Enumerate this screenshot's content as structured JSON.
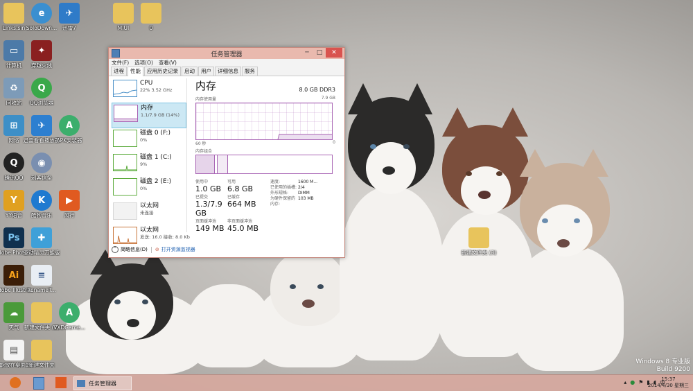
{
  "desktop": {
    "icons": [
      {
        "label": "Links.sin",
        "icon": "folder-icon"
      },
      {
        "label": "SoloDown...",
        "icon": "browser-icon"
      },
      {
        "label": "迅雷7",
        "icon": "thunder-icon"
      },
      {
        "label": "MIUI",
        "icon": "folder-icon"
      },
      {
        "label": "0",
        "icon": "folder-icon"
      },
      {
        "label": "计算机",
        "icon": "computer-icon"
      },
      {
        "label": "穿越火线",
        "icon": "game-icon"
      },
      {
        "label": "回收站",
        "icon": "recycle-bin-icon"
      },
      {
        "label": "QQ浏览器",
        "icon": "qq-browser-icon"
      },
      {
        "label": "网络",
        "icon": "network-icon"
      },
      {
        "label": "迅雷看看播放器",
        "icon": "player-icon"
      },
      {
        "label": "APK安装器",
        "icon": "apk-icon"
      },
      {
        "label": "腾讯QQ",
        "icon": "qq-icon"
      },
      {
        "label": "刺客信条",
        "icon": "disc-icon"
      },
      {
        "label": "YY语音",
        "icon": "yy-icon"
      },
      {
        "label": "酷狗音乐",
        "icon": "kugou-icon"
      },
      {
        "label": "风行",
        "icon": "fengxing-icon"
      },
      {
        "label": "Adobe Photosh...",
        "icon": "photoshop-icon"
      },
      {
        "label": "驱动精灵万能版",
        "icon": "driver-icon"
      },
      {
        "label": "Adobe Illustra...",
        "icon": "illustrator-icon"
      },
      {
        "label": "RenameT...",
        "icon": "document-icon"
      },
      {
        "label": "天气",
        "icon": "weather-icon"
      },
      {
        "label": "新建文件夹 (2)",
        "icon": "folder-icon"
      },
      {
        "label": "VXDGame...",
        "icon": "apk-icon"
      },
      {
        "label": "不能放在桌面的文件",
        "icon": "document-icon"
      },
      {
        "label": "新建文件夹",
        "icon": "folder-icon"
      },
      {
        "label": "新建文件夹 (3)",
        "icon": "folder-icon"
      }
    ]
  },
  "window": {
    "title": "任务管理器",
    "buttons": {
      "minimize": "─",
      "maximize": "□",
      "close": "✕"
    },
    "menu": [
      "文件(F)",
      "选项(O)",
      "查看(V)"
    ],
    "tabs": [
      "进程",
      "性能",
      "应用历史记录",
      "启动",
      "用户",
      "详细信息",
      "服务"
    ],
    "active_tab": "性能"
  },
  "resources": [
    {
      "name": "CPU",
      "sub": "22%  3.52 GHz",
      "color": "#4a90c8"
    },
    {
      "name": "内存",
      "sub": "1.1/7.9 GB (14%)",
      "color": "#a864b4",
      "selected": true
    },
    {
      "name": "磁盘 0 (F:)",
      "sub": "0%",
      "color": "#5aaa3a"
    },
    {
      "name": "磁盘 1 (C:)",
      "sub": "9%",
      "color": "#5aaa3a"
    },
    {
      "name": "磁盘 2 (E:)",
      "sub": "0%",
      "color": "#5aaa3a"
    },
    {
      "name": "以太网",
      "sub": "未连接",
      "color": "#b0b0b0"
    },
    {
      "name": "以太网",
      "sub": "发送: 16.0  接收: 8.0 Kb",
      "color": "#c8743a"
    }
  ],
  "memory": {
    "title": "内存",
    "spec": "8.0 GB DDR3",
    "usage_caption": "内存使用量",
    "usage_max": "7.9 GB",
    "usage_fraction": 0.14,
    "time_left": "60 秒",
    "time_right": "0",
    "composition_caption": "内存组合",
    "stats": [
      {
        "key": "使用中",
        "value": "1.0 GB"
      },
      {
        "key": "可用",
        "value": "6.8 GB"
      },
      {
        "key": "已提交",
        "value": "1.3/7.9 GB"
      },
      {
        "key": "已缓存",
        "value": "664 MB"
      },
      {
        "key": "页面缓冲池",
        "value": "149 MB"
      },
      {
        "key": "非页面缓冲池",
        "value": "45.0 MB"
      }
    ],
    "details": [
      {
        "key": "速度:",
        "value": "1600 M..."
      },
      {
        "key": "已使用的插槽:",
        "value": "2/4"
      },
      {
        "key": "外形规格:",
        "value": "DIMM"
      },
      {
        "key": "为硬件保留的内存:",
        "value": "103 MB"
      }
    ]
  },
  "footer": {
    "less_details": "简略信息(D)",
    "open_monitor": "打开资源监视器"
  },
  "taskbar": {
    "app_label": "任务管理器",
    "tray_lang": "中",
    "time": "15:37",
    "date": "2014/4/30 星期三"
  },
  "watermark": {
    "line1": "Windows 8 专业版",
    "line2": "Build 9200"
  }
}
